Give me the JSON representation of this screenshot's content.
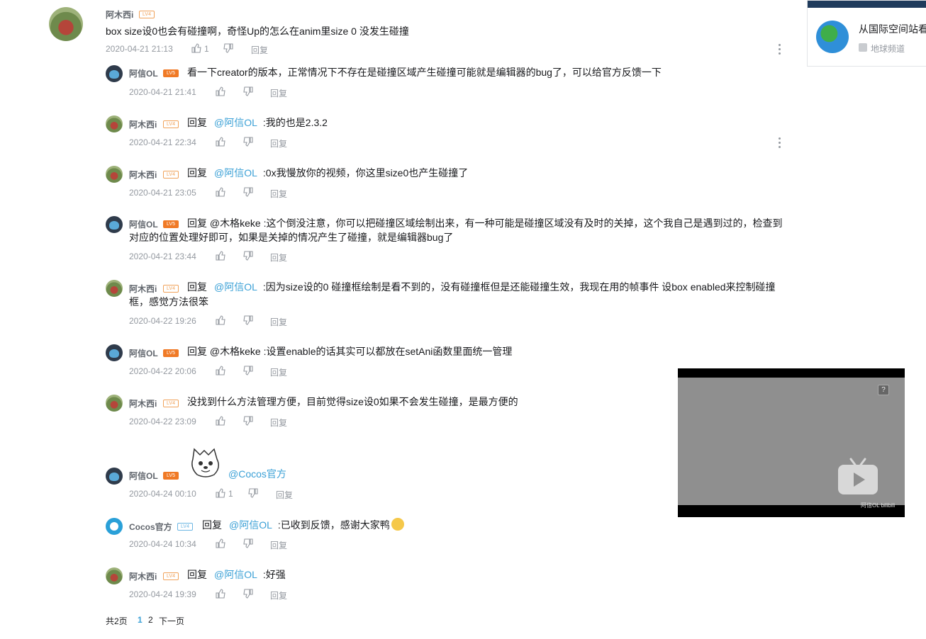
{
  "main_comment": {
    "user": "阿木西i",
    "text": "box size设0也会有碰撞啊，奇怪Up的怎么在anim里size 0 没发生碰撞",
    "time": "2020-04-21 21:13",
    "likes": "1",
    "reply_label": "回复"
  },
  "replies": [
    {
      "user": "阿信OL",
      "text": "看一下creator的版本，正常情况下不存在是碰撞区域产生碰撞可能就是编辑器的bug了，可以给官方反馈一下",
      "time": "2020-04-21 21:41",
      "reply_label": "回复"
    },
    {
      "user": "阿木西i",
      "reply_kw": "回复",
      "at": "@阿信OL",
      "text": ":我的也是2.3.2",
      "time": "2020-04-21 22:34",
      "reply_label": "回复"
    },
    {
      "user": "阿木西i",
      "reply_kw": "回复",
      "at": "@阿信OL",
      "text": ":0x我慢放你的视频，你这里size0也产生碰撞了",
      "time": "2020-04-21 23:05",
      "reply_label": "回复"
    },
    {
      "user": "阿信OL",
      "text_line1": "回复 @木格keke :这个倒没注意，你可以把碰撞区域绘制出来，有一种可能是碰撞区域没有及时的关掉，这个我自己是遇到过的，检查到",
      "text_line2": "对应的位置处理好即可，如果是关掉的情况产生了碰撞，就是编辑器bug了",
      "time": "2020-04-21 23:44",
      "reply_label": "回复"
    },
    {
      "user": "阿木西i",
      "reply_kw": "回复",
      "at": "@阿信OL",
      "text_line1": ":因为size设的0 碰撞框绘制是看不到的，没有碰撞框但是还能碰撞生效，我现在用的帧事件 设box enabled来控制碰撞",
      "text_line2": "框，感觉方法很笨",
      "time": "2020-04-22 19:26",
      "reply_label": "回复"
    },
    {
      "user": "阿信OL",
      "text": "回复 @木格keke :设置enable的话其实可以都放在setAni函数里面统一管理",
      "time": "2020-04-22 20:06",
      "reply_label": "回复"
    },
    {
      "user": "阿木西i",
      "text": "没找到什么方法管理方便，目前觉得size设0如果不会发生碰撞，是最方便的",
      "time": "2020-04-22 23:09",
      "reply_label": "回复"
    },
    {
      "user": "阿信OL",
      "at": "@Cocos官方",
      "time": "2020-04-24 00:10",
      "likes": "1",
      "reply_label": "回复"
    },
    {
      "user": "Cocos官方",
      "reply_kw": "回复",
      "at": "@阿信OL",
      "text": ":已收到反馈，感谢大家鸭",
      "time": "2020-04-24 10:34",
      "reply_label": "回复"
    },
    {
      "user": "阿木西i",
      "reply_kw": "回复",
      "at": "@阿信OL",
      "text": ":好强",
      "time": "2020-04-24 19:39",
      "reply_label": "回复"
    }
  ],
  "pagination": {
    "total": "共2页",
    "page1": "1",
    "page2": "2",
    "next": "下一页"
  },
  "sidebar_card": {
    "title": "从国际空间站看",
    "channel": "地球频道"
  },
  "video": {
    "watermark": "阿信OL bilibili",
    "help": "?"
  },
  "colors": {
    "link": "#3aa0d6",
    "level_badge": "#f07a26",
    "meta_text": "#9499a0"
  }
}
